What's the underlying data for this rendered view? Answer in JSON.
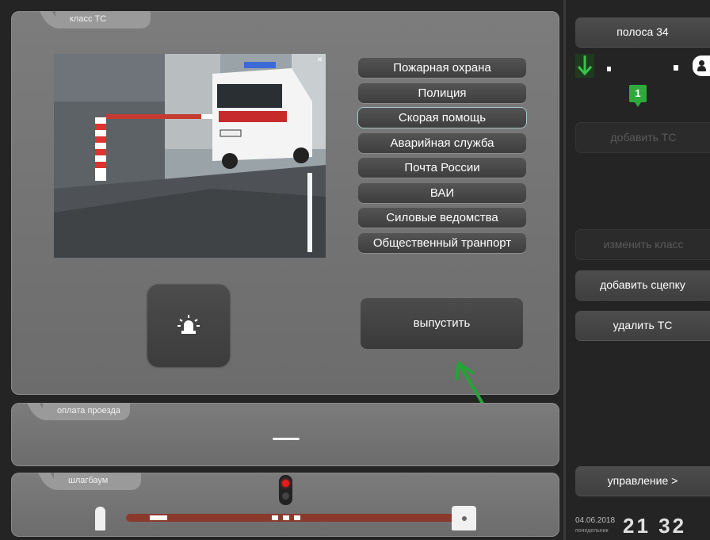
{
  "panels": {
    "class": {
      "tab_label": "класс ТС"
    },
    "payment": {
      "tab_label": "оплата проезда",
      "value": "—"
    },
    "barrier": {
      "tab_label": "шлагбаум"
    }
  },
  "vehicle_classes": [
    "Пожарная охрана",
    "Полиция",
    "Скорая помощь",
    "Аварийная служба",
    "Почта России",
    "ВАИ",
    "Силовые ведомства",
    "Общественный транпорт"
  ],
  "selected_class": "Скорая помощь",
  "camera": {
    "close_label": "×"
  },
  "actions": {
    "release_label": "выпустить"
  },
  "sidebar": {
    "lane_label": "полоса 34",
    "lane_badge": "1",
    "add_vehicle_label": "добавить ТС",
    "change_class_label": "изменить класс",
    "add_trailer_label": "добавить сцепку",
    "delete_vehicle_label": "удалить ТС",
    "control_label": "управление >"
  },
  "datetime": {
    "date": "04.06.2018",
    "weekday": "понедельник",
    "time": "21 32"
  },
  "colors": {
    "accent_green": "#2eaa3d",
    "barrier_arm": "#8a3a2c",
    "signal_red": "#e81a1a"
  }
}
